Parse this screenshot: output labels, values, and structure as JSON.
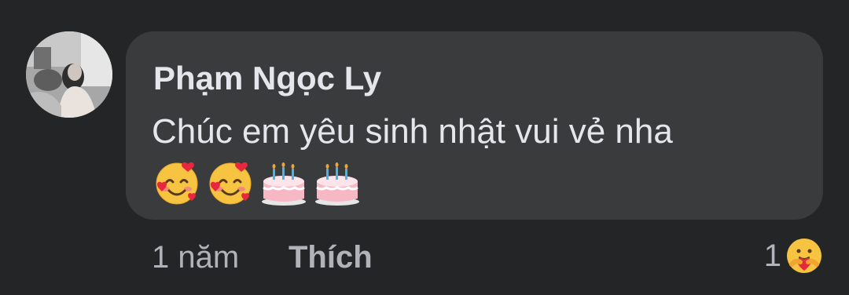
{
  "comment": {
    "author": "Phạm Ngọc Ly",
    "text": "Chúc em yêu sinh nhật vui vẻ nha",
    "emojis": [
      "smiling-face-with-hearts",
      "smiling-face-with-hearts",
      "birthday-cake",
      "birthday-cake"
    ]
  },
  "footer": {
    "time": "1 năm",
    "like_label": "Thích",
    "reaction_count": "1",
    "reaction_icon": "care-reaction-icon"
  },
  "colors": {
    "background": "#242526",
    "bubble": "#3a3b3c",
    "primary_text": "#e4e6eb",
    "secondary_text": "#b0b3b8"
  }
}
